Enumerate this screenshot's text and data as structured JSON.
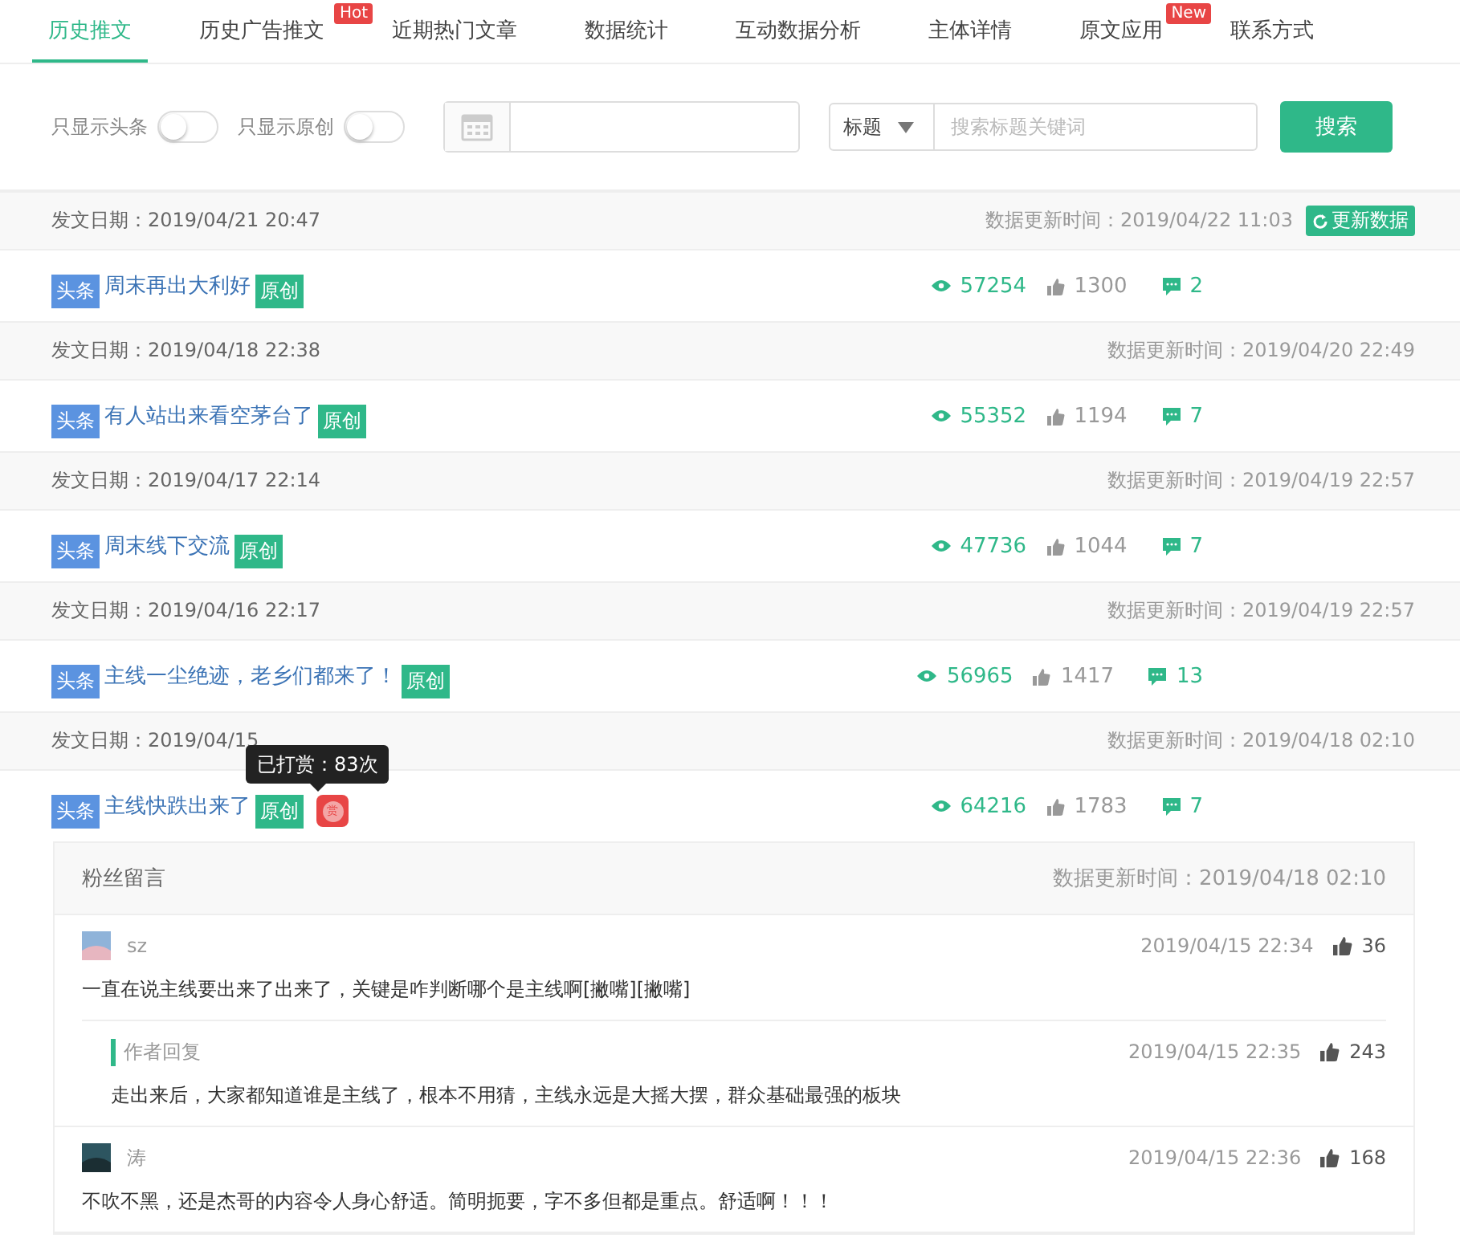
{
  "tabs": [
    {
      "label": "历史推文",
      "selected": true
    },
    {
      "label": "历史广告推文",
      "selected": false,
      "badge": "Hot"
    },
    {
      "label": "近期热门文章",
      "selected": false
    },
    {
      "label": "数据统计",
      "selected": false
    },
    {
      "label": "互动数据分析",
      "selected": false
    },
    {
      "label": "主体详情",
      "selected": false
    },
    {
      "label": "原文应用",
      "selected": false,
      "badge": "New"
    },
    {
      "label": "联系方式",
      "selected": false
    }
  ],
  "filters": {
    "toggles": [
      {
        "label": "只显示头条",
        "on": false
      },
      {
        "label": "只显示原创",
        "on": false
      }
    ],
    "search_type": "标题",
    "search": {
      "placeholder": "搜索标题关键词"
    },
    "search_button": "搜索"
  },
  "articles": [
    {
      "date": "发文日期：2019/04/21 20:47",
      "updated": "数据更新时间：2019/04/22 11:03",
      "refresh_button": "更新数据",
      "tag": "头条",
      "title": "周末再出大利好",
      "original": "原创",
      "views": "57254",
      "likes": "1300",
      "comments": "2"
    },
    {
      "date": "发文日期：2019/04/18 22:38",
      "updated": "数据更新时间：2019/04/20 22:49",
      "tag": "头条",
      "title": "有人站出来看空茅台了",
      "original": "原创",
      "views": "55352",
      "likes": "1194",
      "comments": "7"
    },
    {
      "date": "发文日期：2019/04/17 22:14",
      "updated": "数据更新时间：2019/04/19 22:57",
      "tag": "头条",
      "title": "周末线下交流",
      "original": "原创",
      "views": "47736",
      "likes": "1044",
      "comments": "7"
    },
    {
      "date": "发文日期：2019/04/16 22:17",
      "updated": "数据更新时间：2019/04/19 22:57",
      "tag": "头条",
      "title": "主线一尘绝迹，老乡们都来了！",
      "original": "原创",
      "views": "56965",
      "likes": "1417",
      "comments": "13"
    },
    {
      "date": "发文日期：2019/04/15",
      "updated": "数据更新时间：2019/04/18 02:10",
      "tag": "头条",
      "title": "主线快跌出来了",
      "original": "原创",
      "reward": "赏",
      "tooltip": "已打赏：83次",
      "views": "64216",
      "likes": "1783",
      "comments": "7"
    }
  ],
  "comments_panel": {
    "title": "粉丝留言",
    "updated": "数据更新时间：2019/04/18 02:10",
    "comments": [
      {
        "name": "sz",
        "time": "2019/04/15 22:34",
        "likes": "36",
        "text": "一直在说主线要出来了出来了，关键是咋判断哪个是主线啊[撇嘴][撇嘴]",
        "reply": {
          "label": "作者回复",
          "time": "2019/04/15 22:35",
          "likes": "243",
          "text": "走出来后，大家都知道谁是主线了，根本不用猜，主线永远是大摇大摆，群众基础最强的板块"
        }
      },
      {
        "name": "涛",
        "time": "2019/04/15 22:36",
        "likes": "168",
        "text": "不吹不黑，还是杰哥的内容令人身心舒适。简明扼要，字不多但都是重点。舒适啊！！！"
      }
    ]
  }
}
